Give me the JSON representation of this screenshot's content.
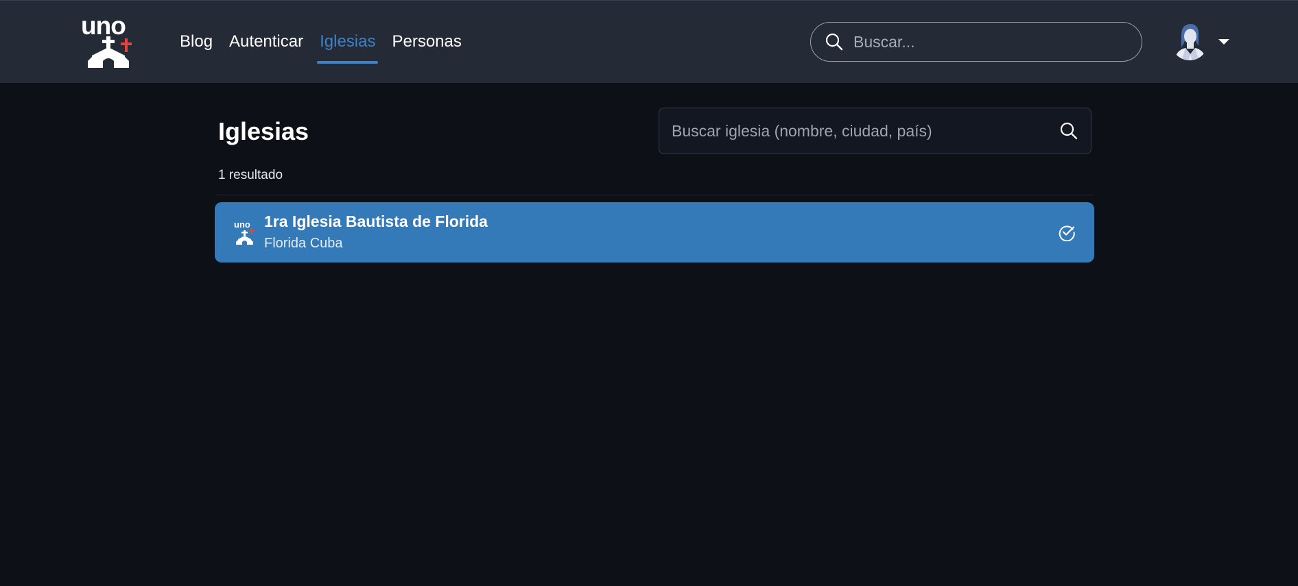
{
  "header": {
    "logo_text": "uno",
    "nav": [
      {
        "label": "Blog",
        "active": false
      },
      {
        "label": "Autenticar",
        "active": false
      },
      {
        "label": "Iglesias",
        "active": true
      },
      {
        "label": "Personas",
        "active": false
      }
    ],
    "search_placeholder": "Buscar...",
    "accent_color": "#3b82c6"
  },
  "main": {
    "title": "Iglesias",
    "search_placeholder": "Buscar iglesia (nombre, ciudad, país)",
    "result_count": "1 resultado",
    "churches": [
      {
        "logo_text": "uno",
        "name": "1ra Iglesia Bautista de Florida",
        "location": "Florida Cuba",
        "selected": true,
        "status_icon": "check-circle-icon"
      }
    ],
    "row_color": "#347ab9"
  }
}
